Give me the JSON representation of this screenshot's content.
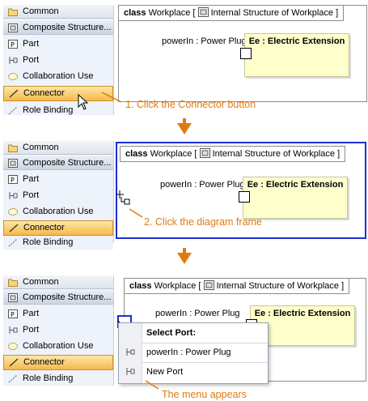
{
  "palette": {
    "items": [
      {
        "label": "Common",
        "icon": "folder-icon"
      },
      {
        "label": "Composite Structure...",
        "icon": "composite-structure-icon"
      },
      {
        "label": "Part",
        "icon": "part-icon"
      },
      {
        "label": "Port",
        "icon": "port-icon"
      },
      {
        "label": "Collaboration Use",
        "icon": "collaboration-use-icon"
      },
      {
        "label": "Connector",
        "icon": "connector-icon"
      },
      {
        "label": "Role Binding",
        "icon": "role-binding-icon"
      }
    ]
  },
  "diagram": {
    "keyword": "class",
    "name": "Workplace [",
    "subtitle": "Internal Structure of Workplace ]",
    "property_label": "powerIn : Power Plug",
    "part_label": "Ee : Electric Extension"
  },
  "steps": [
    {
      "caption": "1. Click the Connector button"
    },
    {
      "caption": "2. Click the diagram frame"
    },
    {
      "caption": "The menu appears"
    }
  ],
  "popup": {
    "title": "Select Port:",
    "items": [
      "powerIn : Power Plug",
      "New Port"
    ]
  },
  "colors": {
    "caption": "#e07a10",
    "selection": "#1d2fd3",
    "palette_selected": "#f6b94b",
    "part_fill": "#ffffcc"
  }
}
